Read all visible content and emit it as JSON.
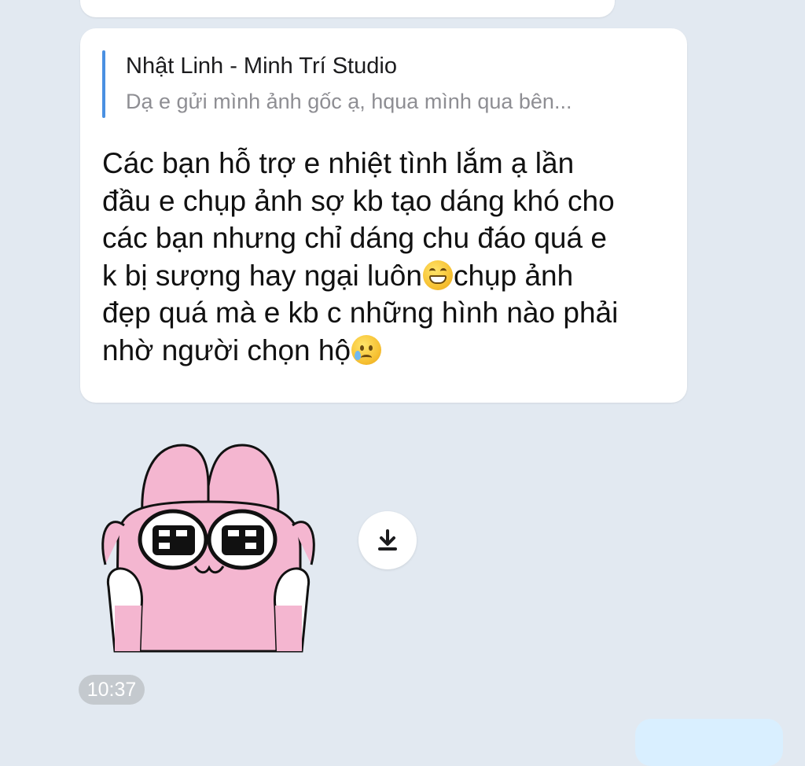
{
  "chat": {
    "message": {
      "reply_quote": {
        "sender": "Nhật Linh - Minh Trí Studio",
        "preview": "Dạ e gửi mình ảnh gốc ạ, hqua mình qua bên..."
      },
      "text_lines": [
        "Các bạn hỗ trợ e nhiệt tình lắm ạ lần",
        "đầu e chụp ảnh sợ kb tạo dáng khó cho",
        "các bạn nhưng chỉ dáng chu đáo quá e",
        "k bị sượng hay ngại luôn",
        "chụp ảnh",
        "đẹp quá mà e kb c những hình nào phải",
        "nhờ người chọn hộ"
      ],
      "emojis": [
        "grinning-face-emoji",
        "face-holding-back-tears-emoji"
      ]
    },
    "sticker": {
      "icon": "pink-bunny-sticker",
      "colors": {
        "body": "#f4b6d0",
        "paws": "#ffffff",
        "outline": "#111111"
      }
    },
    "download_icon": "download-icon",
    "timestamp": "10:37"
  },
  "colors": {
    "background": "#e2e9f1",
    "bubble": "#ffffff",
    "quote_bar": "#4a90e2",
    "timestamp_pill": "#c4c9ce",
    "outgoing_bubble": "#d9efff"
  }
}
